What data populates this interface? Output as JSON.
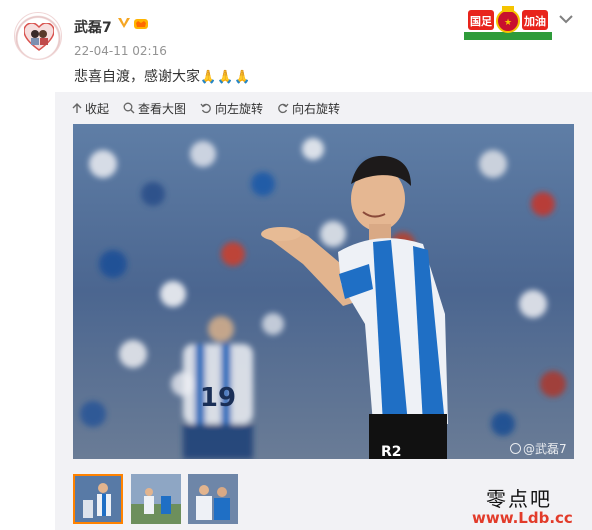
{
  "post": {
    "author": "武磊7",
    "time": "22-04-11 02:16",
    "text": "悲喜自渡，感谢大家",
    "emoji": "🙏🙏🙏"
  },
  "banner": {
    "text": "国足加油"
  },
  "toolbar": {
    "collapse": "收起",
    "view_large": "查看大图",
    "rotate_left": "向左旋转",
    "rotate_right": "向右旋转"
  },
  "image": {
    "shirt_number": "19",
    "sponsor": "R2",
    "watermark": "@武磊7"
  },
  "site": {
    "name_cn": "零点吧",
    "url": "www.Ldb.cc"
  },
  "colors": {
    "accent": "#ff8200",
    "espanyol_blue": "#1f6fc5",
    "url_red": "#e23b2a"
  },
  "icons": [
    "collapse-arrow-icon",
    "zoom-icon",
    "rotate-left-icon",
    "rotate-right-icon",
    "verified-icon",
    "chevron-down-icon"
  ]
}
